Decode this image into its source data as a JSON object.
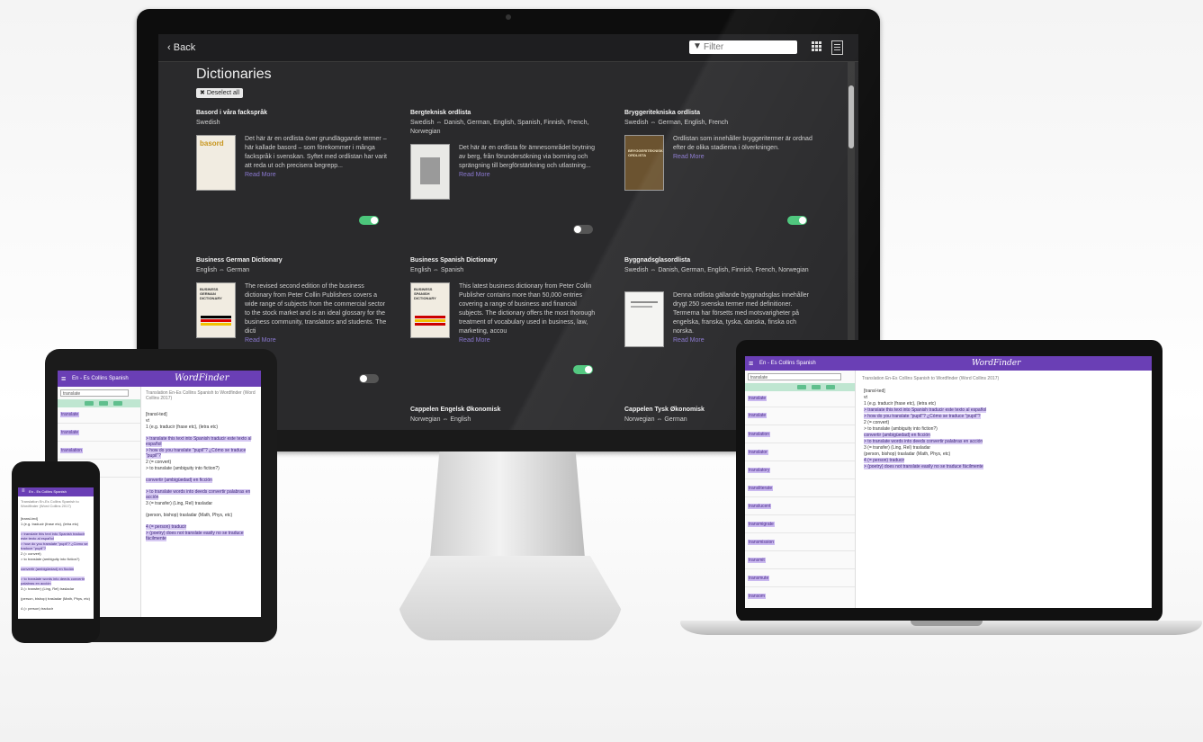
{
  "app": {
    "back_label": "Back",
    "filter_placeholder": "Filter",
    "page_title": "Dictionaries",
    "deselect_all_label": "Deselect all",
    "read_more_label": "Read More"
  },
  "dictionaries": [
    {
      "name": "Basord i våra fackspråk",
      "languages": "Swedish",
      "description": "Det här är en ordlista över grundläggande termer – här kallade basord – som förekommer i många fackspråk i svenskan. Syftet med ordlistan har varit att reda ut och precisera begrepp...",
      "cover_caption": "basord",
      "enabled": true
    },
    {
      "name": "Bergteknisk ordlista",
      "languages": "Swedish ⇔ Danish, German, English, Spanish, Finnish, French, Norwegian",
      "description": "Det här är en ordlista för ämnesområdet brytning av berg, från förundersökning via borrning och sprängning till bergförstärkning och utlastning...",
      "cover_caption": "",
      "enabled": false
    },
    {
      "name": "Bryggeritekniska ordlista",
      "languages": "Swedish ⇔ German, English, French",
      "description": "Ordlistan som innehåller bryggeritermer är ordnad efter de olika stadierna i ölverkningen.",
      "cover_caption": "BRYGGERITEKNISK ORDLISTA",
      "enabled": true
    },
    {
      "name": "Business German Dictionary",
      "languages": "English ⇔ German",
      "description": "The revised second edition of the business dictionary from Peter Collin Publishers covers a wide range of subjects from the commercial sector to the stock market and is an ideal glossary for the business community, translators and students. The dicti",
      "cover_caption": "BUSINESS GERMAN DICTIONARY",
      "enabled": false
    },
    {
      "name": "Business Spanish Dictionary",
      "languages": "English ⇔ Spanish",
      "description": "This latest business dictionary from Peter Collin Publisher contains more than 50,000 entries covering a range of business and financial subjects. The dictionary offers the most thorough treatment of vocabulary used in business, law, marketing, accou",
      "cover_caption": "BUSINESS SPANISH DICTIONARY",
      "enabled": true
    },
    {
      "name": "Byggnadsglasordlista",
      "languages": "Swedish ⇔ Danish, German, English, Finnish, French, Norwegian",
      "description": "Denna ordlista gällande byggnadsglas innehåller drygt 250 svenska termer med definitioner. Termerna har försetts med motsvarigheter på engelska, franska, tyska, danska, finska och norska.",
      "cover_caption": "",
      "enabled": null
    },
    {
      "name": "Cappelen Engelsk Økonomisk",
      "languages": "Norwegian ⇔ English",
      "description": "",
      "cover_caption": "",
      "enabled": null
    },
    {
      "name": "Cappelen Tysk Økonomisk",
      "languages": "Norwegian ⇔ German",
      "description": "",
      "cover_caption": "",
      "enabled": null
    }
  ],
  "wordfinder": {
    "logo": "WordFinder",
    "dictionary_selector": "En - Es Collins Spanish",
    "crumb": "Translation  En-Es Collins Spanish to Wordfinder (Word Collins 2017)",
    "entry_lines": [
      "[transl-ted]",
      "vt",
      "1 (e.g. traducir (frase etc), (letra etc)",
      "> translate this text into Spanish traducir este texto al español",
      "> how do you translate \"pupil\"? ¿Cómo se traduce \"pupil\"?",
      "2 (= convert)",
      "> to translate (ambiguity into fiction?)",
      "convertir (ambigüedad) en ficción",
      "> to translate words into deeds convertir palabras en acción",
      "3 (= transfer) (Ling, Rel) trasladar",
      "(person, bishop) trasladar (Math, Phys, etc)",
      "4 (= person) traducir",
      "> (poetry) does not translate easily no se traduce fácilmente"
    ],
    "list_words": [
      "translate",
      "translate",
      "translation",
      "translator",
      "translatory",
      "transliterate",
      "translucent",
      "transmigrate",
      "transmission",
      "transmit",
      "transmute",
      "transom"
    ]
  }
}
